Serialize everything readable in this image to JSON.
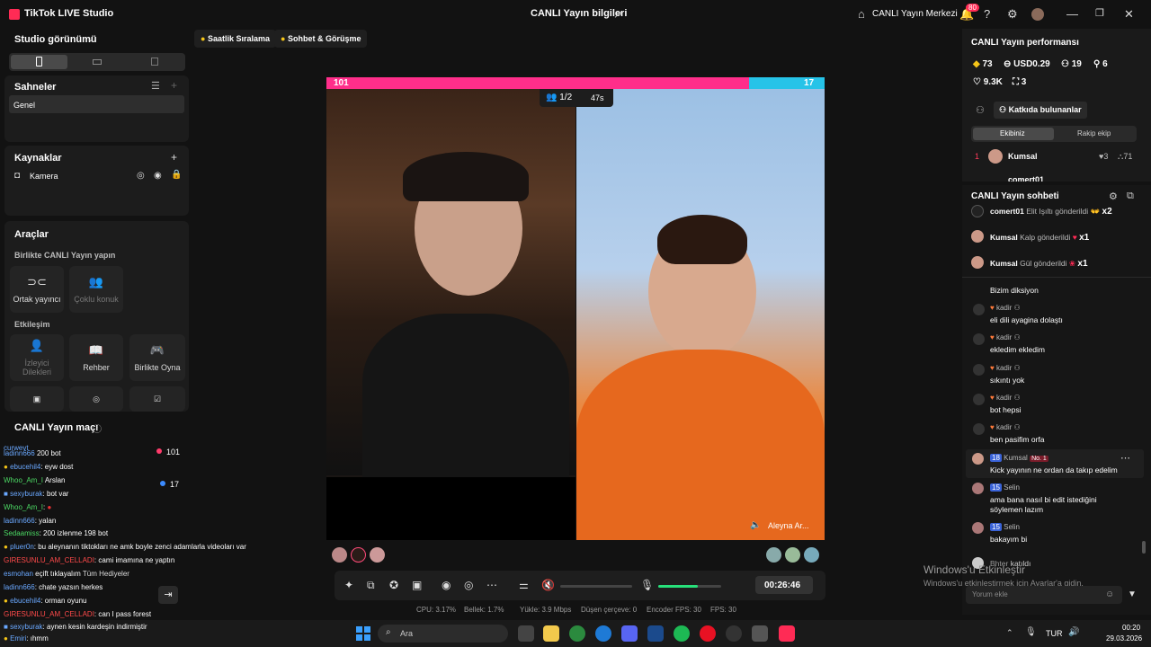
{
  "titlebar": {
    "app_name": "TikTok LIVE Studio",
    "live_info": "CANLI Yayın bilgileri",
    "live_center": "CANLI Yayın Merkezi",
    "notif_count": "80"
  },
  "left": {
    "studio_view": "Studio görünümü",
    "scenes_title": "Sahneler",
    "scene_item": "Genel",
    "sources_title": "Kaynaklar",
    "source_camera": "Kamera",
    "tools_title": "Araçlar",
    "together_live": "Birlikte CANLI Yayın yapın",
    "co_host": "Ortak yayıncı",
    "multi_guest": "Çoklu konuk",
    "interaction": "Etkileşim",
    "viewer_wishes": "İzleyici Dilekleri",
    "guide": "Rehber",
    "play_together": "Birlikte Oyna",
    "match_title": "CANLI Yayın maçı"
  },
  "top_chips": [
    "Saatlik Sıralama",
    "Sohbet & Görüşme"
  ],
  "battle": {
    "left_score": "101",
    "right_score": "17",
    "round": "1/2",
    "timer": "47s",
    "right_user": "Aleyna Ar..."
  },
  "left_chat": [
    {
      "user": "curwevt",
      "msg": "",
      "color": "u-blue"
    },
    {
      "user": "ladinn666",
      "msg": "200 bot",
      "color": "u-blue"
    },
    {
      "user": "ebucehil4",
      "msg": ": eyw dost",
      "color": "u-blue"
    },
    {
      "user": "Whoo_Am_I",
      "msg": "Arslan",
      "color": "u-green"
    },
    {
      "user": "sexyburak",
      "msg": ": bot var",
      "color": "u-blue"
    },
    {
      "user": "Whoo_Am_I",
      "msg": ":",
      "color": "u-green"
    },
    {
      "user": "ladinn666",
      "msg": ": yalan",
      "color": "u-blue"
    },
    {
      "user": "Sedaamiss",
      "msg": ": 200 izlenme 198 bot",
      "color": "u-green"
    },
    {
      "user": "pluer0n",
      "msg": ": bu aleynanın tiktokları ne amk boyle zenci adamlarla videoları var",
      "color": "u-blue"
    },
    {
      "user": "GIRESUNLU_AM_CELLADI",
      "msg": ": cami imamına ne yaptın",
      "color": "u-red"
    },
    {
      "user": "esmohan",
      "msg": "eçift tıklayalım",
      "color": "u-blue"
    },
    {
      "user": "ladinn666",
      "msg": ": chate yazsın herkes",
      "color": "u-blue"
    },
    {
      "user": "ebucehil4",
      "msg": ": orman oyunu",
      "color": "u-blue"
    },
    {
      "user": "GIRESUNLU_AM_CELLADI",
      "msg": ": can I pass forest",
      "color": "u-red"
    },
    {
      "user": "sexyburak",
      "msg": ": aynen kesin kardeşin indirmiştir",
      "color": "u-blue"
    },
    {
      "user": "Emiri",
      "msg": ": ıhmm",
      "color": "u-blue"
    }
  ],
  "left_chat_scores": {
    "top": "101",
    "bottom": "17"
  },
  "gift_overlay": "Tüm Hediyeler",
  "controls": {
    "duration": "00:26:46"
  },
  "stats": {
    "cpu": "CPU: 3.17%",
    "memory": "Bellek: 1.7%",
    "upload": "Yükle: 3.9 Mbps",
    "dropped": "Düşen çerçeve: 0",
    "encoder": "Encoder FPS: 30",
    "fps": "FPS: 30"
  },
  "right": {
    "perf_title": "CANLI Yayın performansı",
    "m1": "73",
    "m2": "USD0.29",
    "m3": "19",
    "m4": "6",
    "m5": "9.3K",
    "m6": "3",
    "contrib_btn": "Katkıda bulunanlar",
    "tab_team": "Ekibiniz",
    "tab_rival": "Rakip ekip",
    "rank_user": "Kumsal",
    "rank_hearts": "3",
    "rank_score": "71",
    "rank_next": "comert01",
    "chat_title": "CANLI Yayın sohbeti",
    "gifts": [
      {
        "user": "comert01",
        "msg": "Elit Işıltı gönderildi",
        "count": "x2"
      },
      {
        "user": "Kumsal",
        "msg": "Kalp gönderildi",
        "count": "x1"
      },
      {
        "user": "Kumsal",
        "msg": "Gül gönderildi",
        "count": "x1"
      }
    ],
    "partial_msg": "Bizim diksiyon",
    "messages": [
      {
        "user": "kadir",
        "msg": "eli dili ayagina dolaştı"
      },
      {
        "user": "kadir",
        "msg": "ekledim ekledim"
      },
      {
        "user": "kadir",
        "msg": "sıkıntı yok"
      },
      {
        "user": "kadir",
        "msg": "bot hepsi"
      },
      {
        "user": "kadir",
        "msg": "ben pasifim orfa"
      }
    ],
    "kumsal_level": "18",
    "kumsal_user": "Kumsal",
    "kumsal_badge": "No. 1",
    "kumsal_msg": "Kick yayının ne ordan da takıp edelim",
    "selin_level": "15",
    "selin_user": "Selin",
    "selin_msg1": "ama bana nasıl bi edit istediğini söylemen lazım",
    "selin_msg2": "bakayım bi",
    "joined_user": "Bhter",
    "joined": "katıldı",
    "comment_ph": "Yorum ekle",
    "win_act1": "Windows'u Etkinleştir",
    "win_act2": "Windows'u etkinleştirmek için Ayarlar'a gidin."
  },
  "taskbar": {
    "search": "Ara",
    "lang": "TUR",
    "time": "00:20",
    "date": "29.03.2026"
  }
}
